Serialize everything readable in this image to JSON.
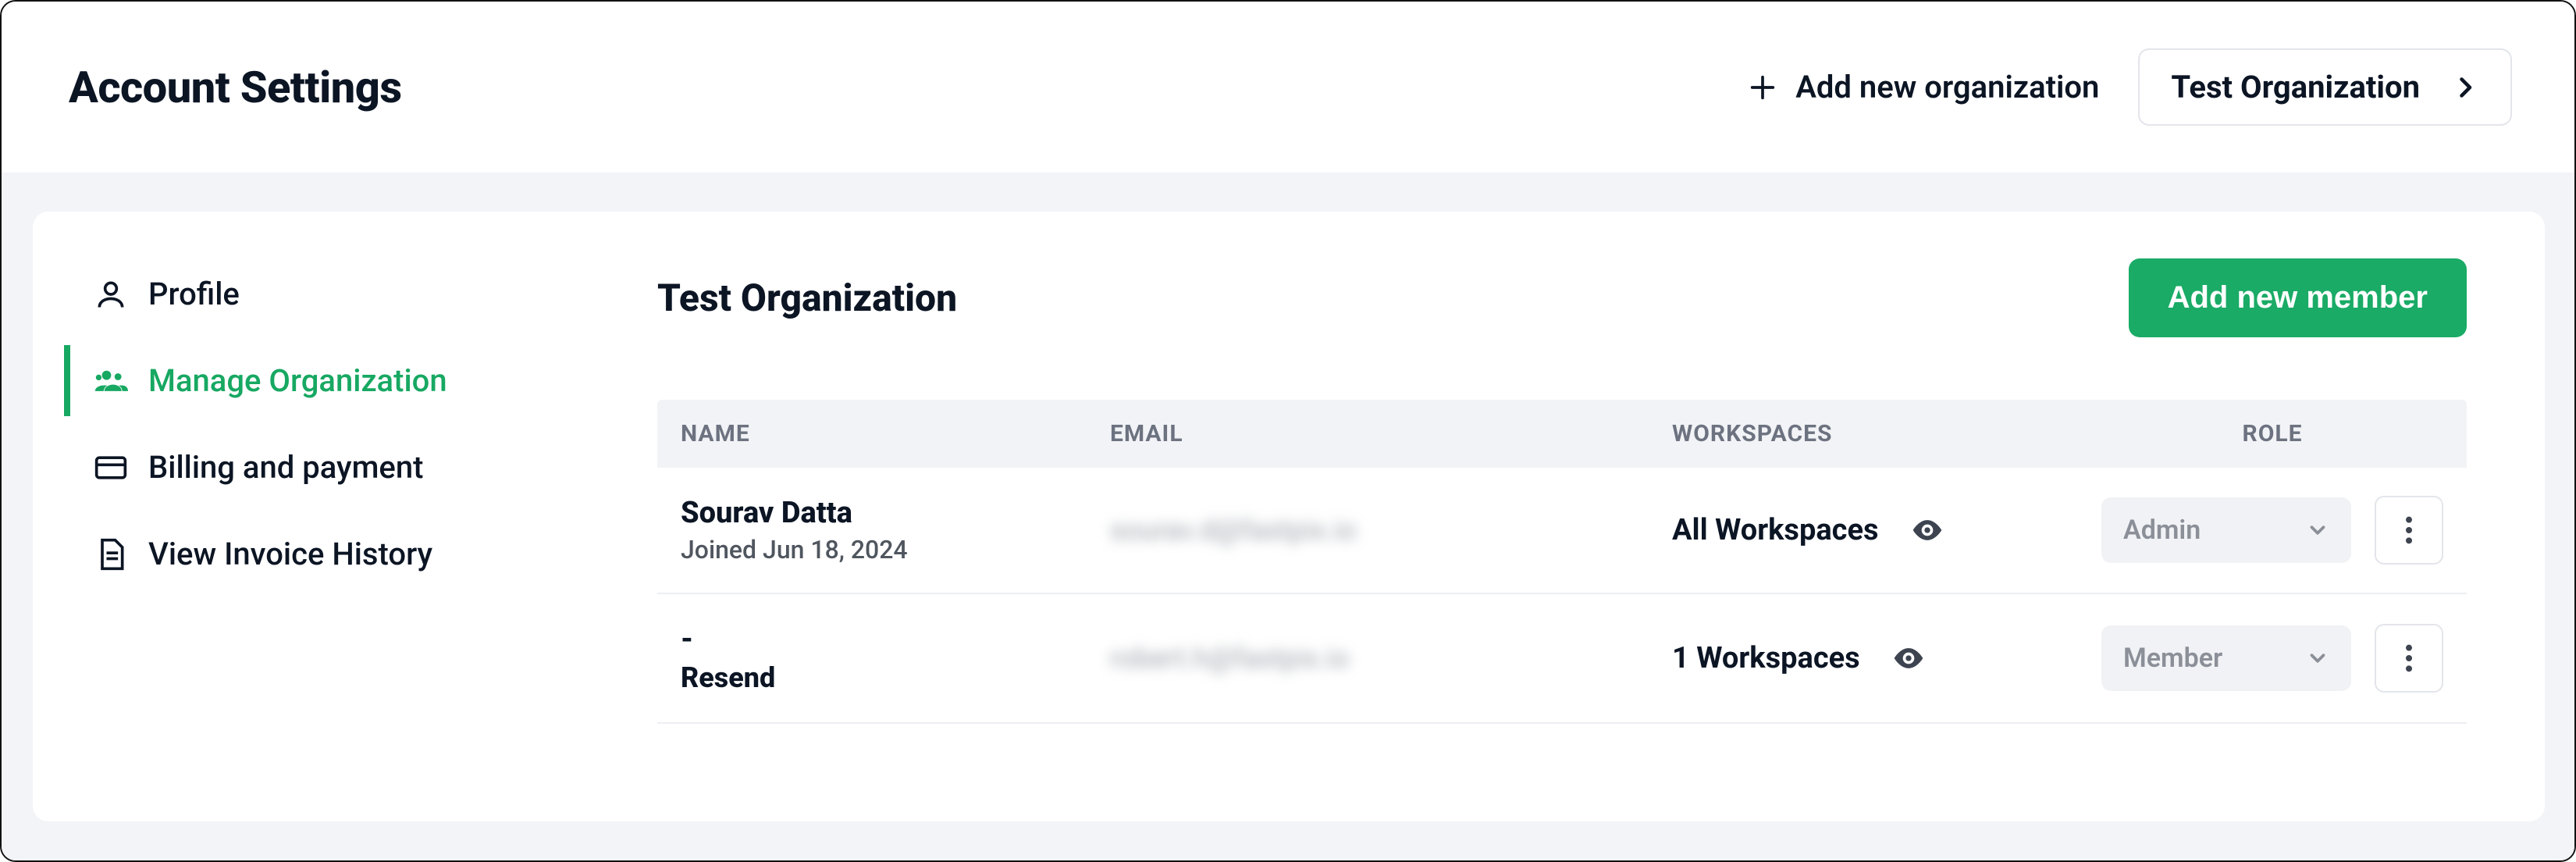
{
  "header": {
    "title": "Account Settings",
    "add_org_label": "Add new organization",
    "org_switcher_label": "Test Organization"
  },
  "sidebar": {
    "items": [
      {
        "label": "Profile"
      },
      {
        "label": "Manage Organization"
      },
      {
        "label": "Billing and payment"
      },
      {
        "label": "View Invoice History"
      }
    ]
  },
  "main": {
    "title": "Test Organization",
    "add_member_label": "Add new member",
    "columns": {
      "name": "NAME",
      "email": "EMAIL",
      "workspaces": "WORKSPACES",
      "role": "ROLE"
    },
    "resend_label": "Resend",
    "members": [
      {
        "name": "Sourav Datta",
        "joined": "Joined Jun 18, 2024",
        "email": "sourav.d@fastpix.io",
        "workspaces": "All Workspaces",
        "role": "Admin"
      },
      {
        "name": "-",
        "joined": "",
        "email": "robert.h@fastpix.io",
        "workspaces": "1 Workspaces",
        "role": "Member"
      }
    ]
  }
}
